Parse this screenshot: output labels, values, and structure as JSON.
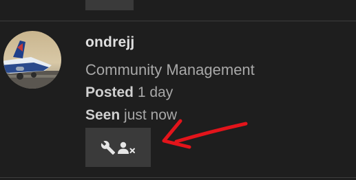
{
  "profile": {
    "username": "ondrejj",
    "title": "Community Management",
    "posted_label": "Posted",
    "posted_value": "1 day",
    "seen_label": "Seen",
    "seen_value": "just now"
  },
  "actions": {
    "icons": [
      "wrench-icon",
      "remove-user-icon"
    ]
  },
  "colors": {
    "background": "#1e1e1e",
    "button": "#3a3a3a",
    "annotation_arrow": "#e3141b"
  }
}
